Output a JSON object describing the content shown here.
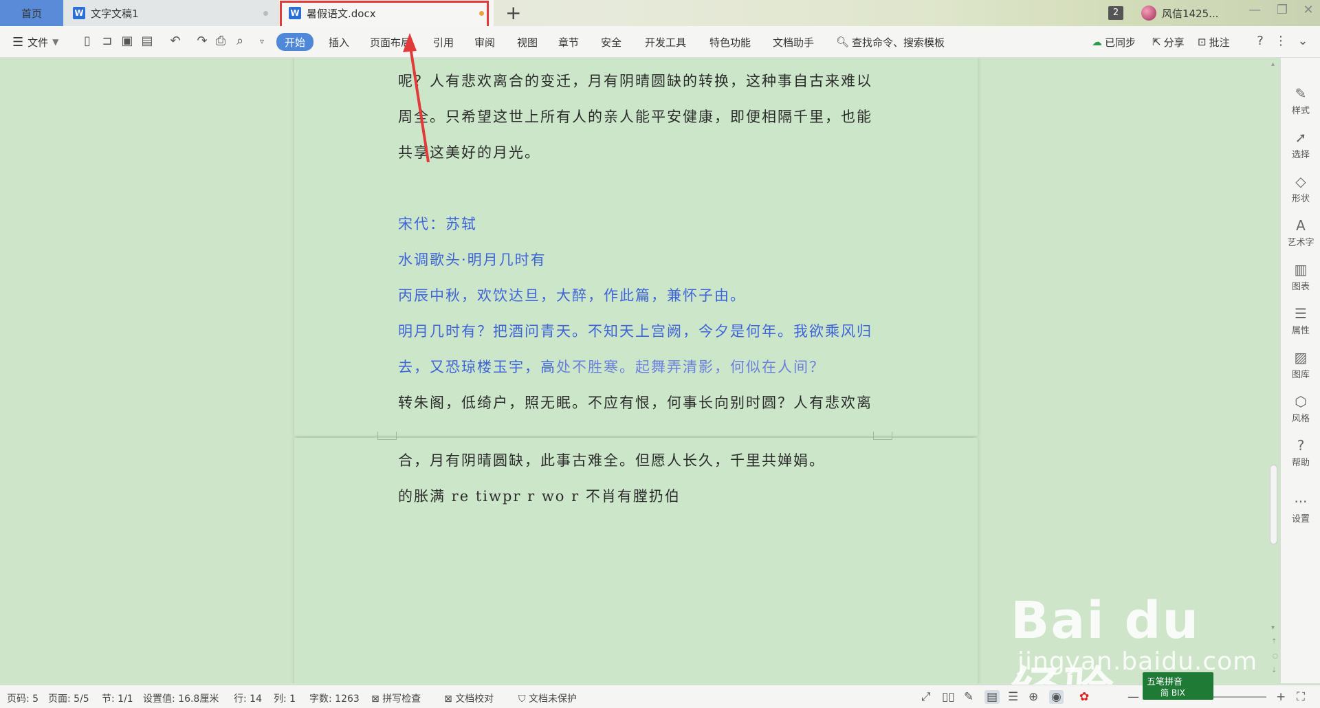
{
  "tabs": {
    "home": "首页",
    "doc1": "文字文稿1",
    "doc2": "暑假语文.docx",
    "new_tab": "+"
  },
  "titlebar": {
    "badge_count": "2",
    "user_name": "风信1425..."
  },
  "menu": {
    "file": "文件",
    "tabs": [
      "开始",
      "插入",
      "页面布局",
      "引用",
      "审阅",
      "视图",
      "章节",
      "安全",
      "开发工具",
      "特色功能",
      "文档助手"
    ],
    "search": "查找命令、搜索模板",
    "sync": "已同步",
    "share": "分享",
    "comment": "批注"
  },
  "document": {
    "lines": [
      "呢？人有悲欢离合的变迁，月有阴晴圆缺的转换，这种事自古来难以",
      "周全。只希望这世上所有人的亲人能平安健康，即便相隔千里，也能",
      "共享这美好的月光。",
      "宋代：苏轼",
      "水调歌头·明月几时有",
      "丙辰中秋，欢饮达旦，大醉，作此篇，兼怀子由。",
      "明月几时有？把酒问青天。不知天上宫阙，今夕是何年。我欲乘风归",
      "去，又恐琼楼玉宇，高",
      "处不胜寒。起舞弄清影，何似在人间？",
      "转朱阁，低绮户，照无眠。不应有恨，何事长向别时圆？人有悲欢离",
      "合，月有阴晴圆缺，此事古难全。但愿人长久，千里共婵娟。",
      "的胀满 re tiwpr r wo r 不肖有膛扔伯"
    ]
  },
  "rightpanel": [
    "样式",
    "选择",
    "形状",
    "艺术字",
    "图表",
    "属性",
    "图库",
    "风格",
    "帮助",
    "设置"
  ],
  "status": {
    "page_code": "页码: 5",
    "pages": "页面: 5/5",
    "section": "节: 1/1",
    "setting": "设置值: 16.8厘米",
    "row": "行: 14",
    "col": "列: 1",
    "words": "字数: 1263",
    "spell": "拼写检查",
    "proof": "文档校对",
    "protect": "文档未保护"
  },
  "ime": {
    "line1": "五笔拼音",
    "line2": "简 BIX"
  },
  "watermark": {
    "main": "Bai du 经验",
    "url": "jingyan.baidu.com"
  }
}
